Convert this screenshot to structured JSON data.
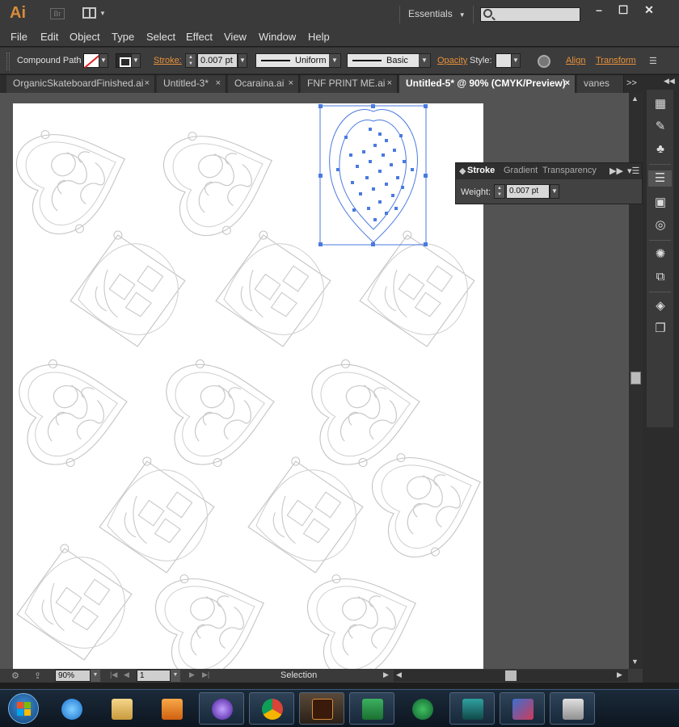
{
  "app": {
    "logo": "Ai",
    "bridge": "Br",
    "workspace": "Essentials",
    "window_buttons": [
      "–",
      "☐",
      "✕"
    ]
  },
  "menu": [
    "File",
    "Edit",
    "Object",
    "Type",
    "Select",
    "Effect",
    "View",
    "Window",
    "Help"
  ],
  "control": {
    "object_type": "Compound Path",
    "stroke_label": "Stroke:",
    "stroke_weight": "0.007 pt",
    "profile": "Uniform",
    "brush": "Basic",
    "opacity_label": "Opacity",
    "style_label": "Style:",
    "align_label": "Align",
    "transform_label": "Transform"
  },
  "tabs": [
    {
      "label": "OrganicSkateboardFinished.ai",
      "close": "×"
    },
    {
      "label": "Untitled-3*",
      "close": "×"
    },
    {
      "label": "Ocaraina.ai",
      "close": "×"
    },
    {
      "label": "FNF PRINT ME.ai",
      "close": "×"
    },
    {
      "label": "Untitled-5* @ 90% (CMYK/Preview)",
      "close": "×"
    },
    {
      "label": "vanes",
      "close": ""
    }
  ],
  "tabs_more": ">>",
  "stroke_panel": {
    "tabs": [
      "Stroke",
      "Gradient",
      "Transparency"
    ],
    "weight_label": "Weight:",
    "weight_value": "0.007 pt"
  },
  "status": {
    "zoom": "90%",
    "page": "1",
    "tool": "Selection"
  },
  "colors": {
    "accent": "#e8913a",
    "selection": "#4a7ae0",
    "outline": "#c8c8c8"
  }
}
